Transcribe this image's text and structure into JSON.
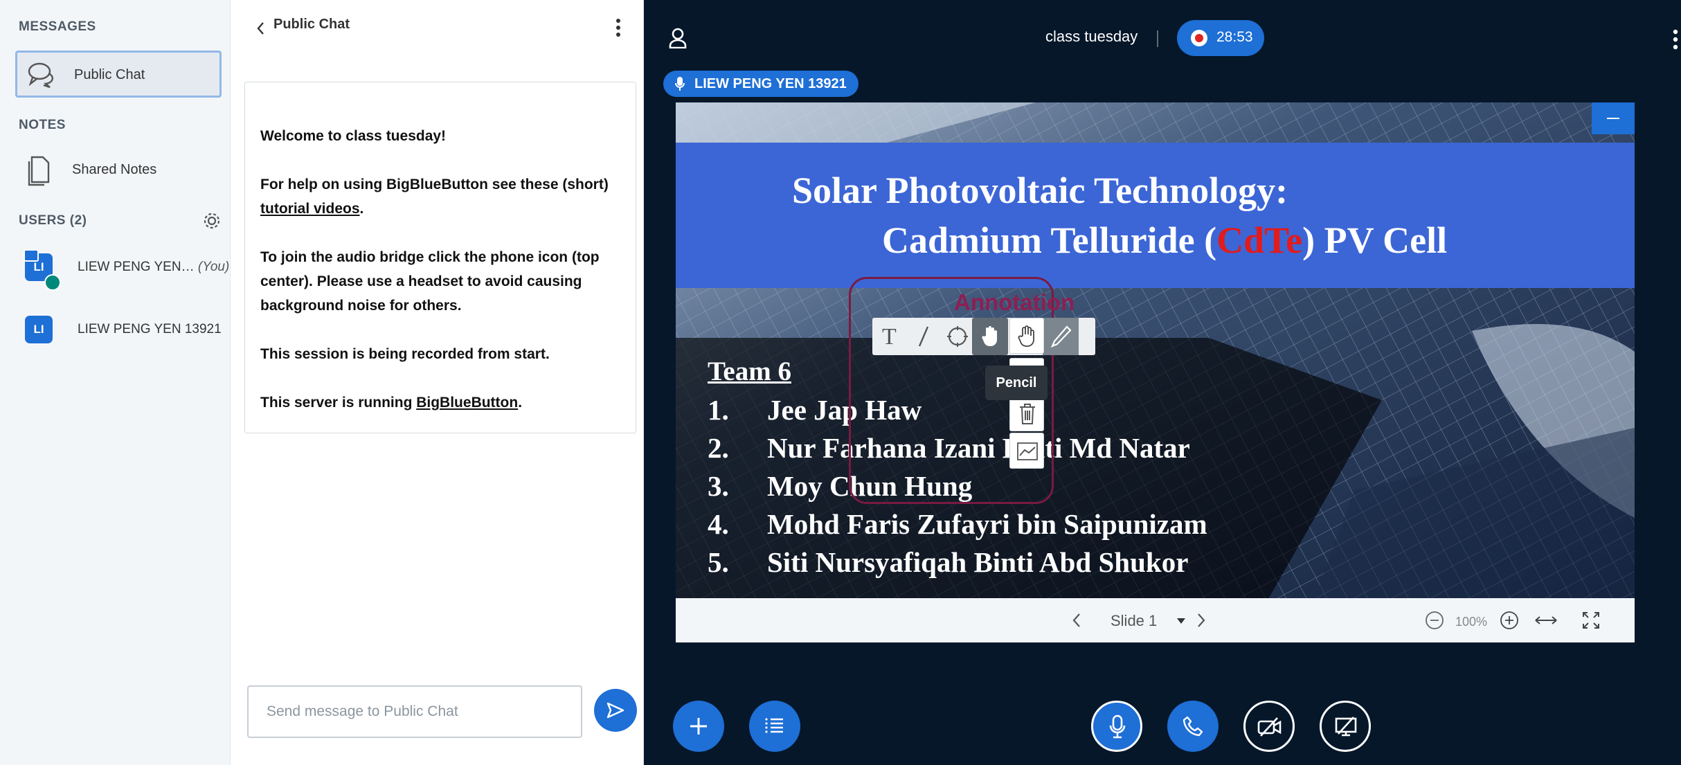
{
  "sidebar": {
    "messages_heading": "MESSAGES",
    "public_chat_label": "Public Chat",
    "notes_heading": "NOTES",
    "shared_notes_label": "Shared Notes",
    "users_heading": "USERS (2)",
    "users": [
      {
        "initials": "LI",
        "name": "LIEW PENG YEN…",
        "you_tag": "(You)"
      },
      {
        "initials": "LI",
        "name": "LIEW PENG YEN 13921",
        "you_tag": ""
      }
    ]
  },
  "chat": {
    "header": "Public Chat",
    "welcome": "Welcome to class tuesday!",
    "help_prefix": "For help on using BigBlueButton see these (short) ",
    "help_link": "tutorial videos",
    "help_suffix": ".",
    "audio_text": "To join the audio bridge click the phone icon (top center). Please use a headset to avoid causing background noise for others.",
    "recorded_text": "This session is being recorded from start.",
    "server_prefix": "This server is running ",
    "server_link": "BigBlueButton",
    "server_suffix": ".",
    "input_placeholder": "Send message to Public Chat"
  },
  "main": {
    "title": "class tuesday",
    "recording_time": "28:53",
    "talker": "LIEW PENG YEN 13921"
  },
  "slide": {
    "title_line1": "Solar Photovoltaic Technology:",
    "title_line2_a": "Cadmium Telluride  (",
    "title_line2_b": "CdTe",
    "title_line2_c": ") PV Cell",
    "team_heading": "Team 6",
    "members": [
      {
        "num": "1.",
        "name": "Jee Jap Haw"
      },
      {
        "num": "2.",
        "name": "Nur Farhana Izani Binti Md Natar"
      },
      {
        "num": "3.",
        "name": "Moy Chun Hung"
      },
      {
        "num": "4.",
        "name": "Mohd Faris Zufayri bin Saipunizam"
      },
      {
        "num": "5.",
        "name": "Siti Nursyafiqah Binti Abd Shukor"
      }
    ],
    "slide_label": "Slide 1",
    "zoom": "100%"
  },
  "annotation": {
    "caption": "Annotation",
    "tooltip": "Pencil",
    "tools": [
      "T",
      "line",
      "ellipse",
      "triangle",
      "rectangle",
      "pencil",
      "hand"
    ]
  },
  "colors": {
    "accent": "#1e6fd6",
    "dark_bg": "#06172a",
    "annotation": "#8c1f53",
    "cdte": "#e21b1b"
  }
}
